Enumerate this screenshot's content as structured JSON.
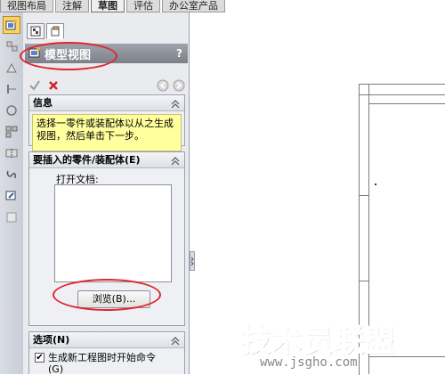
{
  "top_tabs": [
    {
      "label": "视图布局"
    },
    {
      "label": "注解"
    },
    {
      "label": "草图"
    },
    {
      "label": "评估"
    },
    {
      "label": "办公室产品"
    }
  ],
  "active_top_tab": "草图",
  "left_toolbar_icons": [
    "model-view-icon",
    "projected-view-icon",
    "auxiliary-view-icon",
    "section-view-icon",
    "detail-view-icon",
    "standard-3-view-icon",
    "broken-view-icon",
    "crop-view-icon",
    "alternate-position-icon",
    "relative-view-icon"
  ],
  "panel": {
    "title": "模型视图",
    "help": "?",
    "info": {
      "header": "信息",
      "message": "选择一零件或装配体以从之生成视图，然后单击下一步。"
    },
    "insert": {
      "header": "要插入的零件/装配体(E)",
      "open_docs_label": "打开文档:",
      "browse_label": "浏览(B)..."
    },
    "options": {
      "header": "选项(N)",
      "checkbox_label": "生成新工程图时开始命令",
      "checkbox_label_cont": "(G)",
      "checked": true
    }
  },
  "watermark": {
    "title": "技术员联盟",
    "url": "www.jsgho.com"
  },
  "colors": {
    "highlight": "#e0262f",
    "info_bg": "#ffff9e",
    "header_bg": "#8a8e97"
  }
}
